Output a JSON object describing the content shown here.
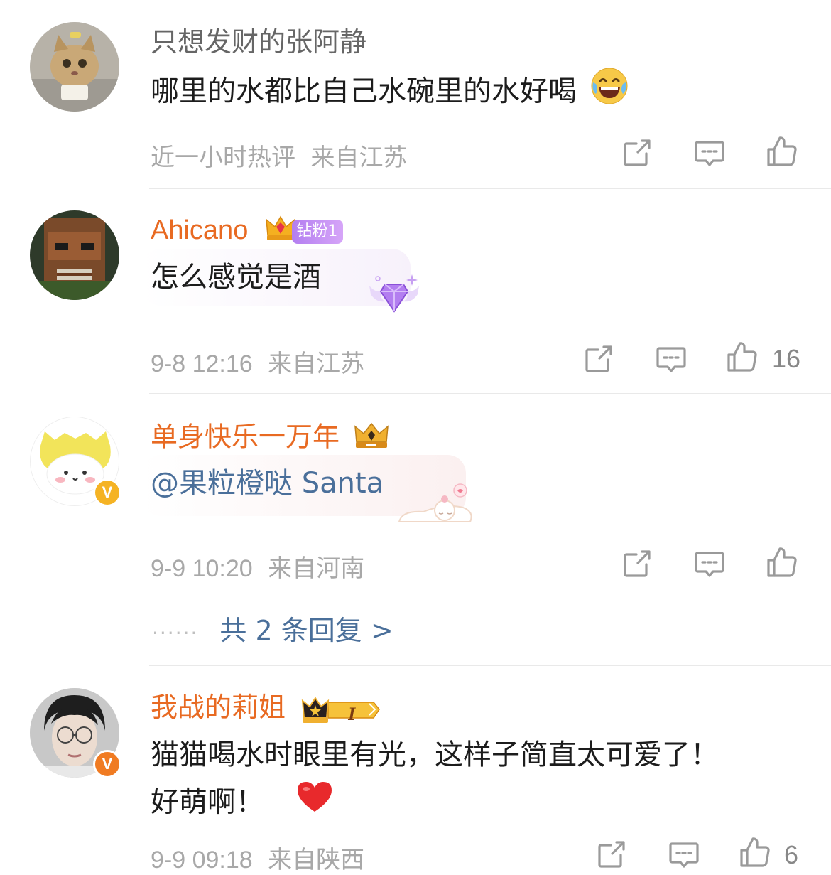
{
  "comments": [
    {
      "username": "只想发财的张阿静",
      "text": "哪里的水都比自己水碗里的水好喝",
      "time": "近一小时热评",
      "location": "来自江苏",
      "likes": ""
    },
    {
      "username": "Ahicano",
      "fan_badge": "钻粉1",
      "text": "怎么感觉是酒",
      "time": "9-8 12:16",
      "location": "来自江苏",
      "likes": "16"
    },
    {
      "username": "单身快乐一万年",
      "mention": "@果粒橙哒 Santa",
      "time": "9-9 10:20",
      "location": "来自河南",
      "likes": "",
      "replies_label": "共 2 条回复 >",
      "verified_badge": "V"
    },
    {
      "username": "我战的莉姐",
      "level_badge": "I",
      "text_line1": "猫猫喝水时眼里有光，这样子简直太可爱了！",
      "text_line2": "好萌啊！",
      "time": "9-9 09:18",
      "location": "来自陕西",
      "likes": "6",
      "verified_badge": "V"
    }
  ],
  "icons": {
    "share": "share-icon",
    "comment": "comment-icon",
    "like": "thumbs-up-icon",
    "emoji": "laughing-tears-emoji",
    "heart": "red-heart-emoji"
  },
  "colors": {
    "username_orange": "#e86a22",
    "mention_blue": "#4a6f9a",
    "meta_gray": "#a8a8a8",
    "verified_yellow": "#f5b324",
    "verified_orange": "#f07b22"
  }
}
